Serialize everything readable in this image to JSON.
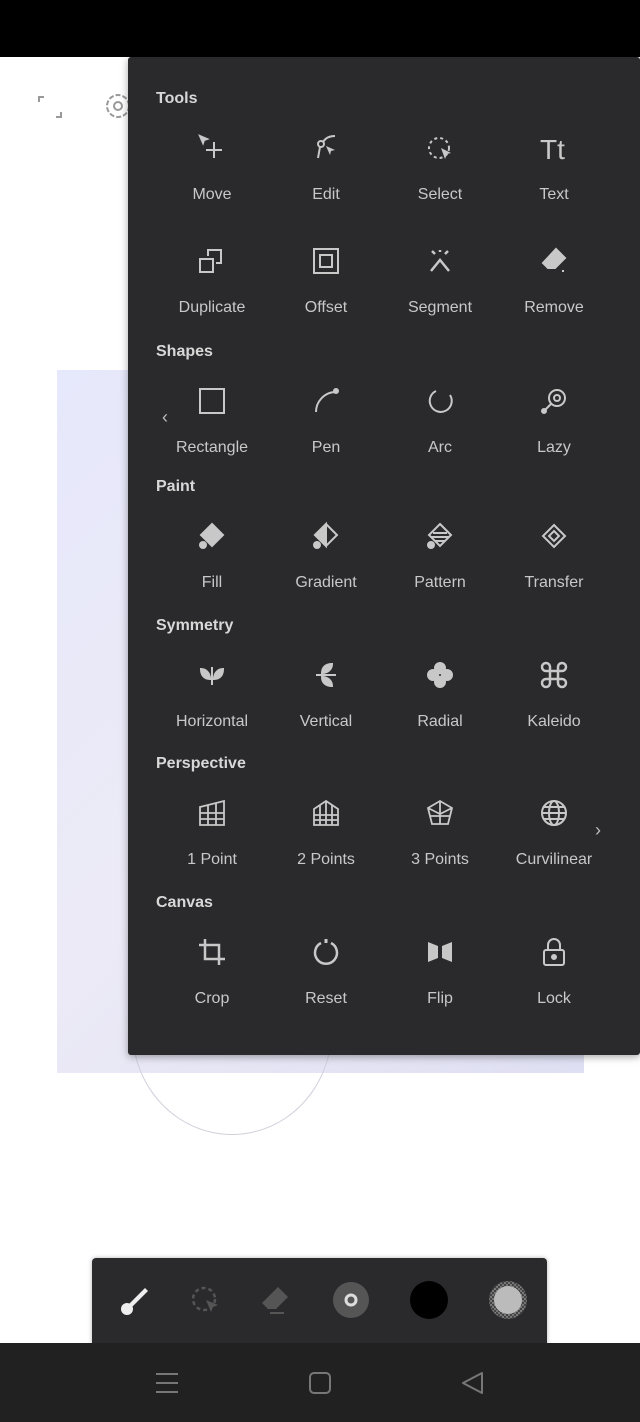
{
  "panel": {
    "sections": [
      {
        "title": "Tools",
        "items": [
          {
            "label": "Move",
            "icon": "move-icon"
          },
          {
            "label": "Edit",
            "icon": "edit-icon"
          },
          {
            "label": "Select",
            "icon": "select-icon"
          },
          {
            "label": "Text",
            "icon": "text-icon"
          },
          {
            "label": "Duplicate",
            "icon": "duplicate-icon"
          },
          {
            "label": "Offset",
            "icon": "offset-icon"
          },
          {
            "label": "Segment",
            "icon": "segment-icon"
          },
          {
            "label": "Remove",
            "icon": "remove-icon"
          }
        ]
      },
      {
        "title": "Shapes",
        "items": [
          {
            "label": "Rectangle",
            "icon": "rectangle-icon"
          },
          {
            "label": "Pen",
            "icon": "pen-icon"
          },
          {
            "label": "Arc",
            "icon": "arc-icon"
          },
          {
            "label": "Lazy",
            "icon": "lazy-icon"
          }
        ]
      },
      {
        "title": "Paint",
        "items": [
          {
            "label": "Fill",
            "icon": "fill-icon"
          },
          {
            "label": "Gradient",
            "icon": "gradient-icon"
          },
          {
            "label": "Pattern",
            "icon": "pattern-icon"
          },
          {
            "label": "Transfer",
            "icon": "transfer-icon"
          }
        ]
      },
      {
        "title": "Symmetry",
        "items": [
          {
            "label": "Horizontal",
            "icon": "horizontal-symmetry-icon"
          },
          {
            "label": "Vertical",
            "icon": "vertical-symmetry-icon"
          },
          {
            "label": "Radial",
            "icon": "radial-icon"
          },
          {
            "label": "Kaleido",
            "icon": "kaleido-icon"
          }
        ]
      },
      {
        "title": "Perspective",
        "items": [
          {
            "label": "1 Point",
            "icon": "one-point-icon"
          },
          {
            "label": "2 Points",
            "icon": "two-points-icon"
          },
          {
            "label": "3 Points",
            "icon": "three-points-icon"
          },
          {
            "label": "Curvilinear",
            "icon": "curvilinear-icon"
          }
        ]
      },
      {
        "title": "Canvas",
        "items": [
          {
            "label": "Crop",
            "icon": "crop-icon"
          },
          {
            "label": "Reset",
            "icon": "reset-icon"
          },
          {
            "label": "Flip",
            "icon": "flip-icon"
          },
          {
            "label": "Lock",
            "icon": "lock-icon"
          }
        ]
      }
    ],
    "prev_glyph": "‹",
    "next_glyph": "›"
  },
  "toolbar": {
    "items": [
      "brush-icon",
      "select-icon",
      "eraser-icon",
      "brush-size-icon",
      "color-swatch",
      "opacity-swatch"
    ],
    "color": "#000000"
  },
  "colors": {
    "panel": "#2a2a2c",
    "navbar": "#212121",
    "icon": "#c8c8c8"
  }
}
